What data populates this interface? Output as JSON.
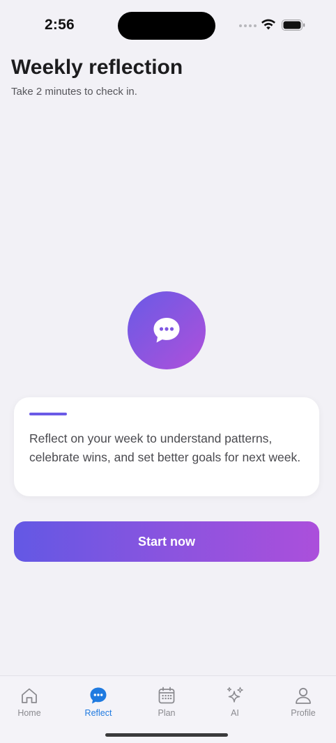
{
  "status_bar": {
    "time": "2:56"
  },
  "header": {
    "title": "Weekly reflection",
    "subtitle": "Take 2 minutes to check in."
  },
  "hero": {
    "icon": "chat-bubble-ellipsis-icon"
  },
  "card": {
    "text": "Reflect on your week to understand patterns, celebrate wins, and set better goals for next week."
  },
  "cta": {
    "label": "Start now"
  },
  "tabs": [
    {
      "label": "Home",
      "icon": "home-icon",
      "active": false
    },
    {
      "label": "Reflect",
      "icon": "chat-bubble-icon",
      "active": true
    },
    {
      "label": "Plan",
      "icon": "calendar-icon",
      "active": false
    },
    {
      "label": "AI",
      "icon": "sparkles-icon",
      "active": false
    },
    {
      "label": "Profile",
      "icon": "person-icon",
      "active": false
    }
  ],
  "colors": {
    "accent_purple": "#6a5ae6",
    "accent_magenta": "#ab4fdb",
    "tab_active": "#1f7ae0",
    "tab_inactive": "#8a8a8f",
    "background": "#f2f1f6"
  }
}
